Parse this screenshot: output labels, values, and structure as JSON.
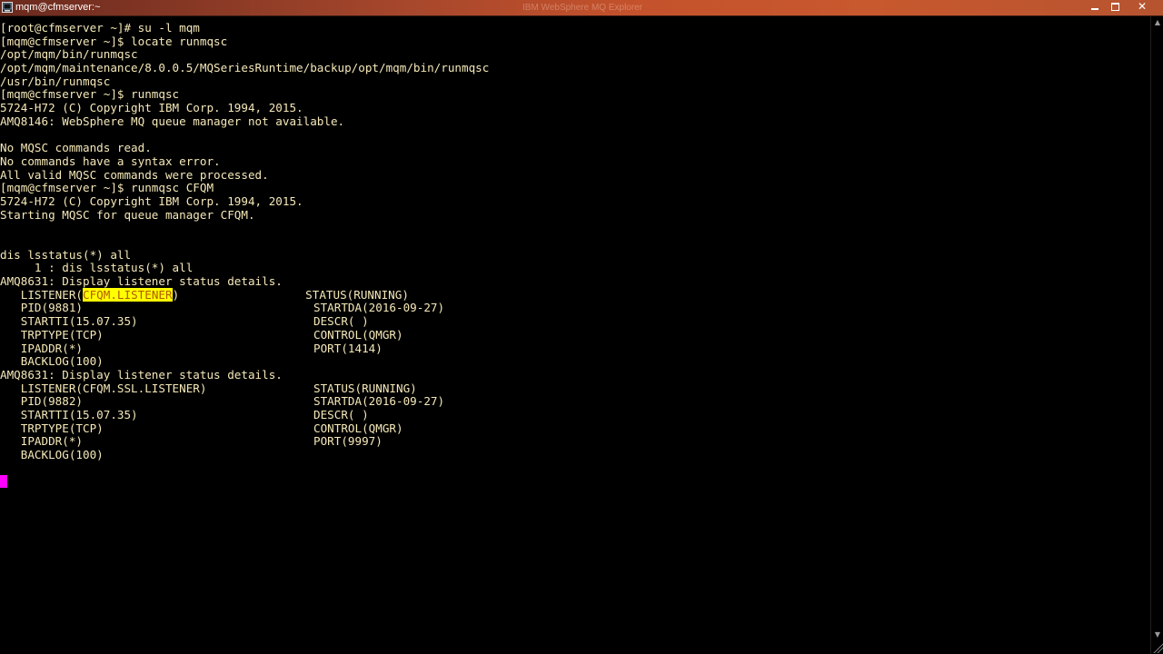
{
  "window": {
    "title": "mqm@cfmserver:~",
    "background_app_title": "IBM WebSphere MQ Explorer",
    "controls": {
      "minimize_icon": "minimize-icon",
      "maximize_icon": "maximize-icon",
      "close_icon": "close-icon",
      "close_glyph": "✕"
    }
  },
  "colors": {
    "terminal_background": "#000000",
    "terminal_text": "#f5e8b8",
    "highlight_background": "#ffff00",
    "highlight_text": "#b05a00",
    "cursor": "#ff00ff",
    "titlebar": "#c4522c"
  },
  "terminal": {
    "lines": [
      "[root@cfmserver ~]# su -l mqm",
      "[mqm@cfmserver ~]$ locate runmqsc",
      "/opt/mqm/bin/runmqsc",
      "/opt/mqm/maintenance/8.0.0.5/MQSeriesRuntime/backup/opt/mqm/bin/runmqsc",
      "/usr/bin/runmqsc",
      "[mqm@cfmserver ~]$ runmqsc",
      "5724-H72 (C) Copyright IBM Corp. 1994, 2015.",
      "AMQ8146: WebSphere MQ queue manager not available.",
      "",
      "No MQSC commands read.",
      "No commands have a syntax error.",
      "All valid MQSC commands were processed.",
      "[mqm@cfmserver ~]$ runmqsc CFQM",
      "5724-H72 (C) Copyright IBM Corp. 1994, 2015.",
      "Starting MQSC for queue manager CFQM.",
      "",
      "",
      "dis lsstatus(*) all",
      "     1 : dis lsstatus(*) all",
      "AMQ8631: Display listener status details."
    ],
    "listener_1": {
      "listener_prefix": "   LISTENER(",
      "listener_name": "CFQM.LISTENER",
      "listener_suffix": ")",
      "status": "STATUS(RUNNING)",
      "lines": [
        {
          "left": "   PID(9881)",
          "right": "STARTDA(2016-09-27)"
        },
        {
          "left": "   STARTTI(15.07.35)",
          "right": "DESCR( )"
        },
        {
          "left": "   TRPTYPE(TCP)",
          "right": "CONTROL(QMGR)"
        },
        {
          "left": "   IPADDR(*)",
          "right": "PORT(1414)"
        },
        {
          "left": "   BACKLOG(100)",
          "right": ""
        }
      ]
    },
    "header_2": "AMQ8631: Display listener status details.",
    "listener_2": {
      "listener": "   LISTENER(CFQM.SSL.LISTENER)",
      "status": "STATUS(RUNNING)",
      "lines": [
        {
          "left": "   PID(9882)",
          "right": "STARTDA(2016-09-27)"
        },
        {
          "left": "   STARTTI(15.07.35)",
          "right": "DESCR( )"
        },
        {
          "left": "   TRPTYPE(TCP)",
          "right": "CONTROL(QMGR)"
        },
        {
          "left": "   IPADDR(*)",
          "right": "PORT(9997)"
        },
        {
          "left": "   BACKLOG(100)",
          "right": ""
        }
      ]
    }
  },
  "scrollbar": {
    "up_arrow_icon": "scroll-up-arrow-icon",
    "down_arrow_icon": "scroll-down-arrow-icon",
    "up_glyph": "▲",
    "down_glyph": "▼"
  }
}
